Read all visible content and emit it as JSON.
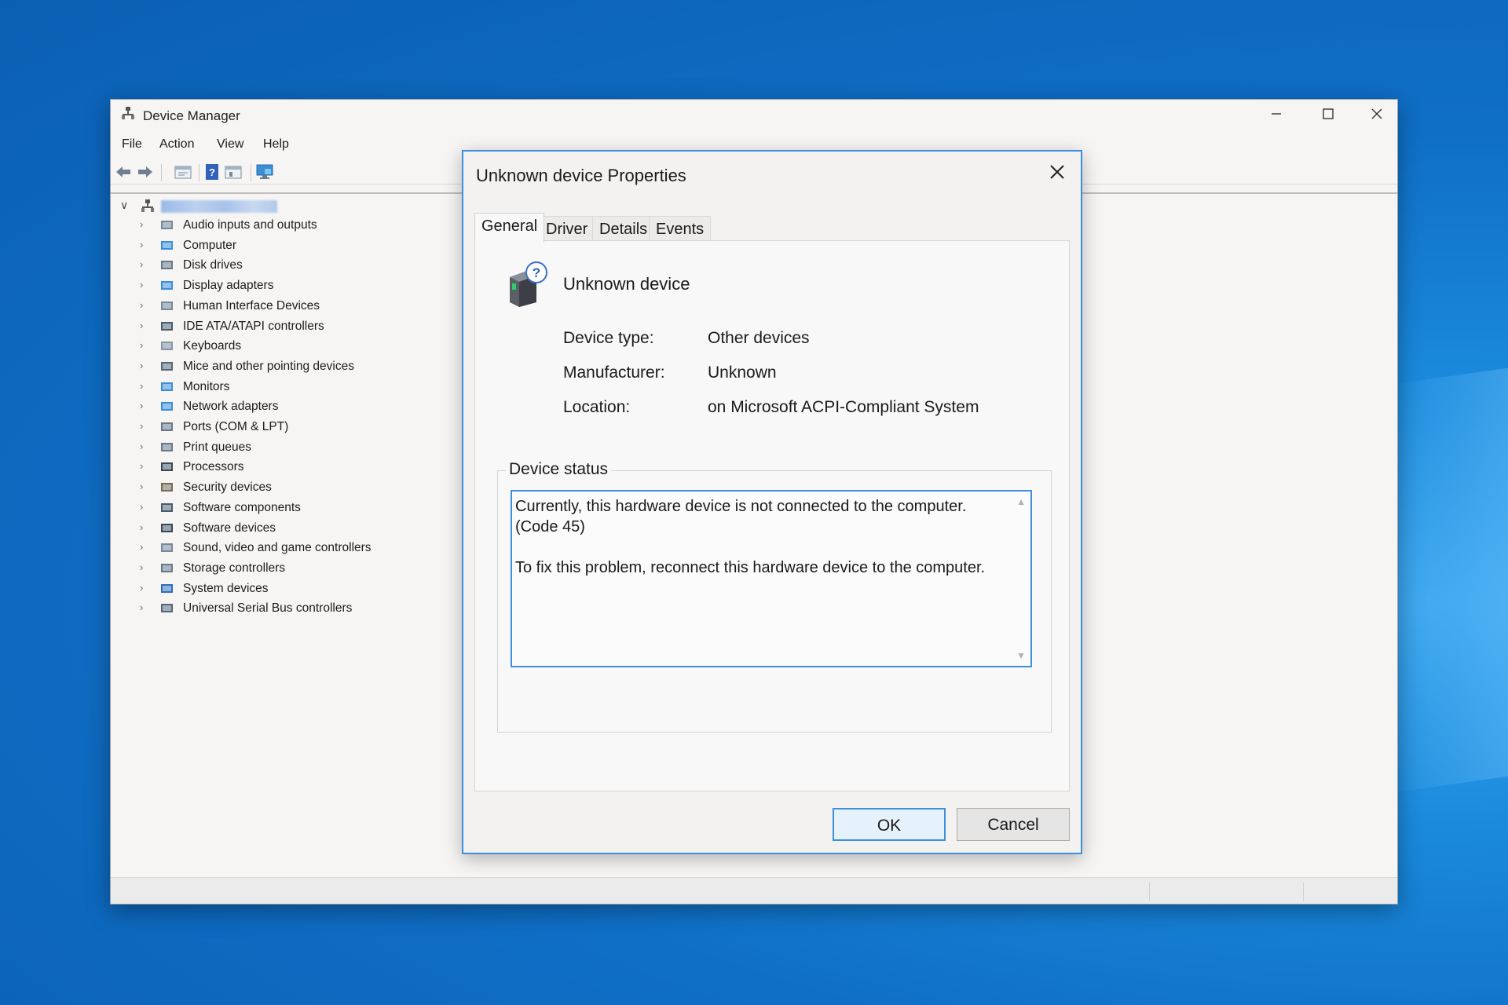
{
  "window": {
    "title": "Device Manager",
    "icon": "device-manager-icon",
    "controls": [
      "minimize",
      "maximize",
      "close"
    ]
  },
  "menu": [
    "File",
    "Action",
    "View",
    "Help"
  ],
  "toolbar": [
    "back-arrow-icon",
    "forward-arrow-icon",
    "properties-icon",
    "help-icon",
    "update-driver-icon",
    "monitor-scan-icon"
  ],
  "tree": {
    "root_name": "",
    "items": [
      {
        "label": "Audio inputs and outputs",
        "icon": "speaker-icon"
      },
      {
        "label": "Computer",
        "icon": "computer-icon"
      },
      {
        "label": "Disk drives",
        "icon": "disk-drive-icon"
      },
      {
        "label": "Display adapters",
        "icon": "display-adapter-icon"
      },
      {
        "label": "Human Interface Devices",
        "icon": "hid-icon"
      },
      {
        "label": "IDE ATA/ATAPI controllers",
        "icon": "ide-controller-icon"
      },
      {
        "label": "Keyboards",
        "icon": "keyboard-icon"
      },
      {
        "label": "Mice and other pointing devices",
        "icon": "mouse-icon"
      },
      {
        "label": "Monitors",
        "icon": "monitor-icon"
      },
      {
        "label": "Network adapters",
        "icon": "network-adapter-icon"
      },
      {
        "label": "Ports (COM & LPT)",
        "icon": "port-icon"
      },
      {
        "label": "Print queues",
        "icon": "printer-icon"
      },
      {
        "label": "Processors",
        "icon": "processor-icon"
      },
      {
        "label": "Security devices",
        "icon": "security-device-icon"
      },
      {
        "label": "Software components",
        "icon": "software-component-icon"
      },
      {
        "label": "Software devices",
        "icon": "software-device-icon"
      },
      {
        "label": "Sound, video and game controllers",
        "icon": "sound-controller-icon"
      },
      {
        "label": "Storage controllers",
        "icon": "storage-controller-icon"
      },
      {
        "label": "System devices",
        "icon": "system-device-icon"
      },
      {
        "label": "Universal Serial Bus controllers",
        "icon": "usb-icon"
      }
    ]
  },
  "dialog": {
    "title": "Unknown device Properties",
    "tabs": [
      "General",
      "Driver",
      "Details",
      "Events"
    ],
    "active_tab": "General",
    "device_name": "Unknown device",
    "properties": [
      {
        "label": "Device type:",
        "value": "Other devices"
      },
      {
        "label": "Manufacturer:",
        "value": "Unknown"
      },
      {
        "label": "Location:",
        "value": "on Microsoft ACPI-Compliant System"
      }
    ],
    "status_legend": "Device status",
    "status_lines": [
      "Currently, this hardware device is not connected to the computer. (Code 45)",
      "To fix this problem, reconnect this hardware device to the computer."
    ],
    "ok_label": "OK",
    "cancel_label": "Cancel"
  },
  "colors": {
    "accent": "#3c8fdb",
    "desktop": "#0f6fc6",
    "window_bg": "#f7f5f4"
  }
}
